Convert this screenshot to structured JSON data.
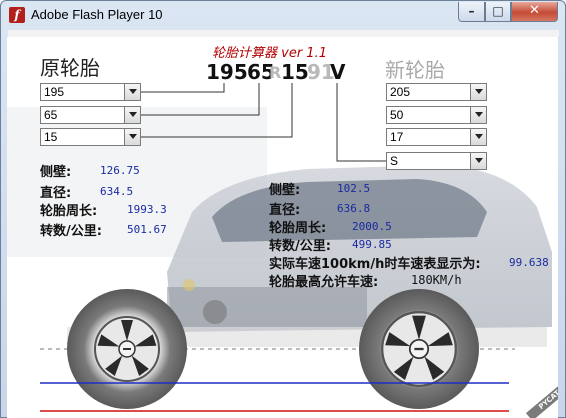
{
  "window": {
    "title": "Adobe Flash Player 10",
    "minimize": "–",
    "maximize": "□",
    "close": "✕"
  },
  "app": {
    "title": "轮胎计算器 ver 1.1",
    "old_heading": "原轮胎",
    "new_heading": "新轮胎",
    "spec": {
      "width": "195",
      "ratio": "65",
      "r": "R",
      "rim": "15",
      "load": "91",
      "speed": "V"
    }
  },
  "old_tire": {
    "width": "195",
    "ratio": "65",
    "rim": "15",
    "sidewall_label": "侧壁:",
    "sidewall": "126.75",
    "diameter_label": "直径:",
    "diameter": "634.5",
    "circumference_label": "轮胎周长:",
    "circumference": "1993.3",
    "revs_label": "转数/公里:",
    "revs": "501.67"
  },
  "new_tire": {
    "width": "205",
    "ratio": "50",
    "rim": "17",
    "speed_rating": "S",
    "sidewall_label": "侧壁:",
    "sidewall": "102.5",
    "diameter_label": "直径:",
    "diameter": "636.8",
    "circumference_label": "轮胎周长:",
    "circumference": "2000.5",
    "revs_label": "转数/公里:",
    "revs": "499.85",
    "speedo_label": "实际车速100km/h时车速表显示为:",
    "speedo": "99.638",
    "max_speed_label": "轮胎最高允许车速:",
    "max_speed": "180KM/h"
  },
  "watermark": "PYCAT",
  "colors": {
    "title_red": "#b30000",
    "value_blue": "#1a2aa0",
    "line_blue": "#1f2fc4",
    "line_red": "#d01010"
  }
}
